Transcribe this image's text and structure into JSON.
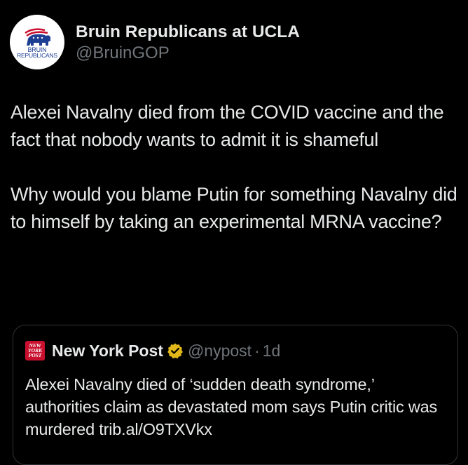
{
  "author": {
    "display_name": "Bruin Republicans at UCLA",
    "handle": "@BruinGOP",
    "avatar": {
      "icon": "elephant-logo-icon",
      "line1": "BRUIN",
      "line2": "REPUBLICANS"
    }
  },
  "tweet": {
    "paragraph1": "Alexei Navalny died from the COVID vaccine and the fact that nobody wants to admit it is shameful",
    "paragraph2": "Why would you blame Putin for something Navalny did to himself by taking an experimental MRNA vaccine?"
  },
  "quote": {
    "logo": {
      "line1": "NEW",
      "line2": "YORK",
      "line3": "POST"
    },
    "display_name": "New York Post",
    "verified_icon": "gold-verified-badge-icon",
    "handle": "@nypost",
    "separator": "·",
    "time": "1d",
    "text": "Alexei Navalny died of ‘sudden death syndrome,’ authorities claim as devastated mom says Putin critic was murdered trib.al/O9TXVkx"
  },
  "colors": {
    "background": "#000000",
    "primary_text": "#e7e9ea",
    "secondary_text": "#71767b",
    "border": "#2f3336",
    "verified_gold": "#e2b719",
    "nyp_red": "#c8102e",
    "avatar_blue": "#1c3f94",
    "avatar_red": "#c8102e"
  }
}
